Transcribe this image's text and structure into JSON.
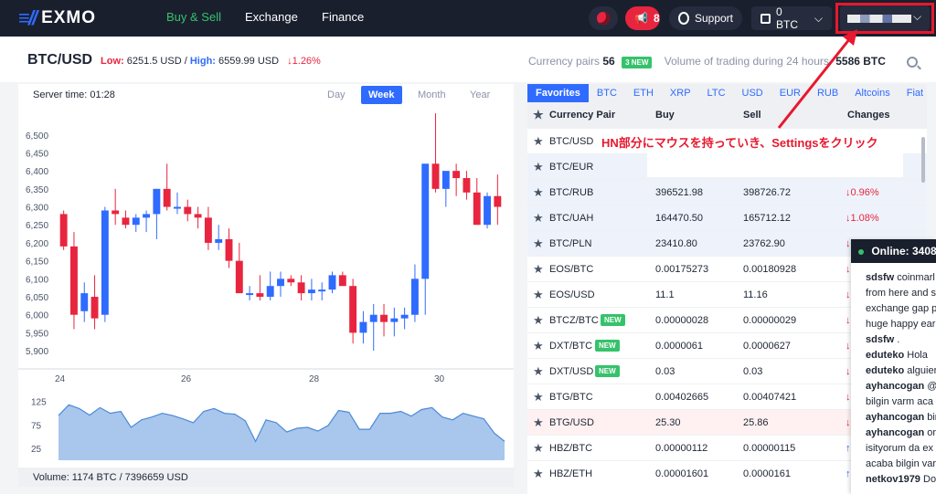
{
  "header": {
    "logo": "EXMO",
    "nav": [
      "Buy & Sell",
      "Exchange",
      "Finance"
    ],
    "notifications": "8",
    "support": "Support",
    "balance": "0 BTC"
  },
  "pair": {
    "name": "BTC/USD",
    "low_label": "Low:",
    "low_value": "6251.5 USD",
    "high_label": "High:",
    "high_value": "6559.99 USD",
    "change": "↓1.26%",
    "currency_pairs_label": "Currency pairs",
    "currency_pairs_count": "56",
    "new_count": "3 NEW",
    "volume_label": "Volume of trading during 24 hours",
    "volume_value": "5586 BTC"
  },
  "chart": {
    "server_time": "Server time: 01:28",
    "periods": [
      "Day",
      "Week",
      "Month",
      "Year"
    ],
    "volume": "Volume: 1174 BTC / 7396659 USD"
  },
  "chart_data": {
    "type": "candlestick",
    "y_ticks": [
      "6,500",
      "6,450",
      "6,400",
      "6,350",
      "6,300",
      "6,250",
      "6,200",
      "6,150",
      "6,100",
      "6,050",
      "6,000",
      "5,950",
      "5,900"
    ],
    "x_ticks": [
      "24",
      "26",
      "28",
      "30"
    ],
    "ylim": [
      5880,
      6540
    ],
    "candles": [
      [
        6280,
        6290,
        6180,
        6190
      ],
      [
        6190,
        6230,
        5960,
        6000
      ],
      [
        6010,
        6090,
        5980,
        6060
      ],
      [
        6050,
        6110,
        5960,
        5990
      ],
      [
        6000,
        6300,
        5980,
        6290
      ],
      [
        6290,
        6350,
        6250,
        6280
      ],
      [
        6270,
        6290,
        6240,
        6250
      ],
      [
        6250,
        6280,
        6230,
        6270
      ],
      [
        6270,
        6290,
        6230,
        6280
      ],
      [
        6280,
        6350,
        6210,
        6350
      ],
      [
        6350,
        6420,
        6290,
        6300
      ],
      [
        6300,
        6340,
        6280,
        6300
      ],
      [
        6300,
        6320,
        6260,
        6280
      ],
      [
        6280,
        6300,
        6240,
        6270
      ],
      [
        6270,
        6300,
        6180,
        6200
      ],
      [
        6200,
        6250,
        6180,
        6210
      ],
      [
        6210,
        6240,
        6130,
        6150
      ],
      [
        6150,
        6200,
        6060,
        6060
      ],
      [
        6060,
        6080,
        6040,
        6060
      ],
      [
        6060,
        6110,
        6040,
        6050
      ],
      [
        6050,
        6120,
        6040,
        6080
      ],
      [
        6080,
        6120,
        6050,
        6100
      ],
      [
        6100,
        6110,
        6080,
        6090
      ],
      [
        6090,
        6110,
        6040,
        6060
      ],
      [
        6060,
        6100,
        6040,
        6070
      ],
      [
        6070,
        6090,
        6040,
        6070
      ],
      [
        6070,
        6120,
        6060,
        6110
      ],
      [
        6110,
        6120,
        6080,
        6080
      ],
      [
        6080,
        6100,
        5920,
        5950
      ],
      [
        5950,
        6010,
        5920,
        5980
      ],
      [
        5980,
        6030,
        5900,
        6000
      ],
      [
        6000,
        6030,
        5940,
        5980
      ],
      [
        5980,
        6020,
        5940,
        5990
      ],
      [
        5990,
        6020,
        5960,
        6000
      ],
      [
        6000,
        6140,
        5980,
        6100
      ],
      [
        6100,
        6320,
        6000,
        6420
      ],
      [
        6420,
        6560,
        6340,
        6350
      ],
      [
        6350,
        6390,
        6300,
        6400
      ],
      [
        6400,
        6420,
        6330,
        6380
      ],
      [
        6380,
        6400,
        6320,
        6340
      ],
      [
        6340,
        6380,
        6250,
        6250
      ],
      [
        6250,
        6340,
        6240,
        6330
      ],
      [
        6330,
        6390,
        6250,
        6300
      ]
    ],
    "volume_ticks": [
      "125",
      "75",
      "25"
    ],
    "volume_ylim": [
      0,
      140
    ],
    "volume_values": [
      95,
      118,
      110,
      96,
      112,
      100,
      104,
      70,
      86,
      92,
      100,
      95,
      88,
      80,
      104,
      110,
      100,
      98,
      84,
      40,
      86,
      80,
      60,
      68,
      70,
      62,
      74,
      106,
      102,
      66,
      66,
      100,
      100,
      104,
      94,
      108,
      112,
      92,
      86,
      100,
      94,
      88,
      58,
      40
    ]
  },
  "pairs": {
    "tabs": [
      "Favorites",
      "BTC",
      "ETH",
      "XRP",
      "LTC",
      "USD",
      "EUR",
      "RUB",
      "Altcoins",
      "Fiat"
    ],
    "columns": [
      "Currency Pair",
      "Buy",
      "Sell",
      "Changes"
    ],
    "rows": [
      {
        "pair": "BTC/USD",
        "buy": "",
        "sell": "",
        "change": "",
        "new": false
      },
      {
        "pair": "BTC/EUR",
        "buy": "",
        "sell": "",
        "change": "",
        "new": false
      },
      {
        "pair": "BTC/RUB",
        "buy": "396521.98",
        "sell": "398726.72",
        "change": "↓0.96%",
        "new": false
      },
      {
        "pair": "BTC/UAH",
        "buy": "164470.50",
        "sell": "165712.12",
        "change": "↓1.08%",
        "new": false
      },
      {
        "pair": "BTC/PLN",
        "buy": "23410.80",
        "sell": "23762.90",
        "change": "↓",
        "new": false
      },
      {
        "pair": "EOS/BTC",
        "buy": "0.00175273",
        "sell": "0.00180928",
        "change": "↓",
        "new": false
      },
      {
        "pair": "EOS/USD",
        "buy": "11.1",
        "sell": "11.16",
        "change": "↓",
        "new": false
      },
      {
        "pair": "BTCZ/BTC",
        "buy": "0.00000028",
        "sell": "0.00000029",
        "change": "↓",
        "new": true
      },
      {
        "pair": "DXT/BTC",
        "buy": "0.0000061",
        "sell": "0.0000627",
        "change": "↓",
        "new": true
      },
      {
        "pair": "DXT/USD",
        "buy": "0.03",
        "sell": "0.03",
        "change": "↓",
        "new": true
      },
      {
        "pair": "BTG/BTC",
        "buy": "0.00402665",
        "sell": "0.00407421",
        "change": "↓",
        "new": false
      },
      {
        "pair": "BTG/USD",
        "buy": "25.30",
        "sell": "25.86",
        "change": "↓",
        "new": false
      },
      {
        "pair": "HBZ/BTC",
        "buy": "0.00000112",
        "sell": "0.00000115",
        "change": "↑",
        "new": false
      },
      {
        "pair": "HBZ/ETH",
        "buy": "0.00001601",
        "sell": "0.0000161",
        "change": "↑",
        "new": false
      }
    ],
    "new_badge": "NEW"
  },
  "annotation": "HN部分にマウスを持っていき、Settingsをクリック",
  "chat": {
    "online": "Online: 3408",
    "messages": [
      {
        "user": "sdsfw",
        "text": " coinmarl"
      },
      {
        "user": "",
        "text": "from here and s"
      },
      {
        "user": "",
        "text": "exchange gap p"
      },
      {
        "user": "",
        "text": "huge happy ear"
      },
      {
        "user": "sdsfw",
        "text": " ."
      },
      {
        "user": "eduteko",
        "text": " Hola"
      },
      {
        "user": "eduteko",
        "text": " alguier"
      },
      {
        "user": "ayhancogan",
        "text": " @"
      },
      {
        "user": "",
        "text": "bilgin varm aca"
      },
      {
        "user": "ayhancogan",
        "text": " bir"
      },
      {
        "user": "ayhancogan",
        "text": " ord"
      },
      {
        "user": "",
        "text": "isityorum da ex"
      },
      {
        "user": "",
        "text": "acaba bilgin var"
      },
      {
        "user": "netkov1979",
        "text": " Do"
      }
    ]
  },
  "colors": {
    "up": "#2f6bff",
    "down": "#e8253f",
    "accent": "#36c26b",
    "header_bg": "#1a1f2e",
    "annotation": "#e8182e"
  }
}
